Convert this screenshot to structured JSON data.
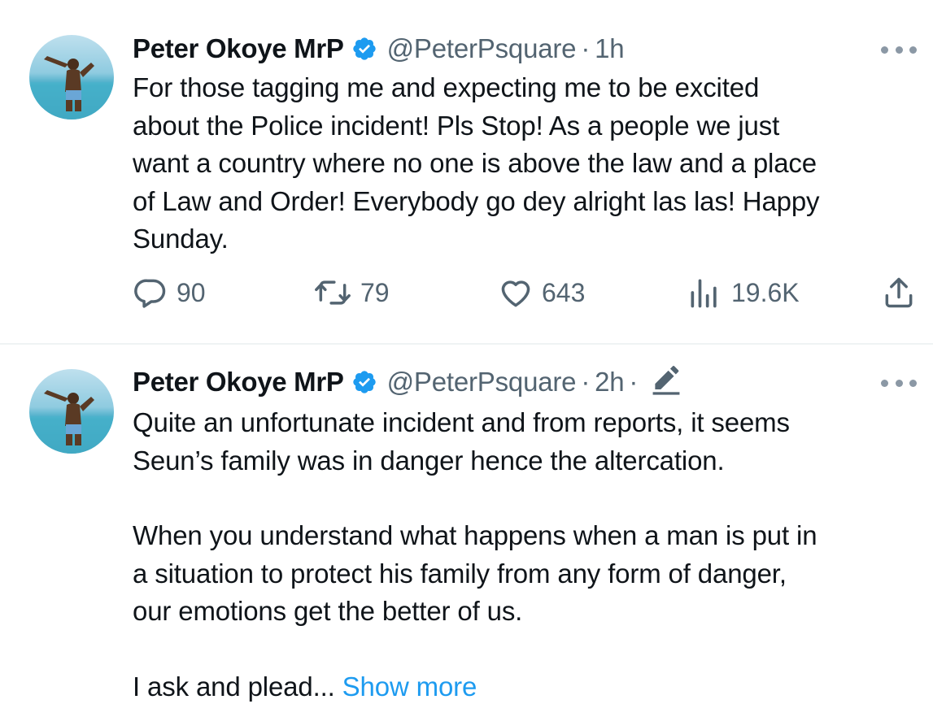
{
  "tweets": [
    {
      "author_name": "Peter Okoye MrP",
      "handle": "@PeterPsquare",
      "separator": "·",
      "time": "1h",
      "text_lines": [
        "For those tagging me and expecting me to be excited",
        "about the Police incident! Pls Stop! As a people we just",
        "want a country where no one is above the law and a place",
        "of Law and Order! Everybody go dey alright las las! Happy",
        "Sunday."
      ],
      "stats": {
        "replies": "90",
        "retweets": "79",
        "likes": "643",
        "views": "19.6K"
      }
    },
    {
      "author_name": "Peter Okoye MrP",
      "handle": "@PeterPsquare",
      "separator": "·",
      "time": "2h",
      "separator2": "·",
      "paragraphs": [
        [
          "Quite an unfortunate incident and from reports, it seems",
          "Seun’s family was in danger hence the altercation."
        ],
        [
          "When you understand what happens when a man is put in",
          "a situation to protect his family from any form of danger,",
          "our emotions get the better of us."
        ]
      ],
      "truncated_line": "I ask and plead...",
      "show_more": "Show more"
    }
  ],
  "colors": {
    "text": "#0f1419",
    "secondary": "#536471",
    "link": "#1d9bf0",
    "verified": "#1d9bf0",
    "divider": "#eff3f4"
  },
  "icons": [
    "verified-badge-icon",
    "more-options-icon",
    "reply-icon",
    "retweet-icon",
    "like-icon",
    "views-icon",
    "share-icon",
    "edit-icon"
  ]
}
